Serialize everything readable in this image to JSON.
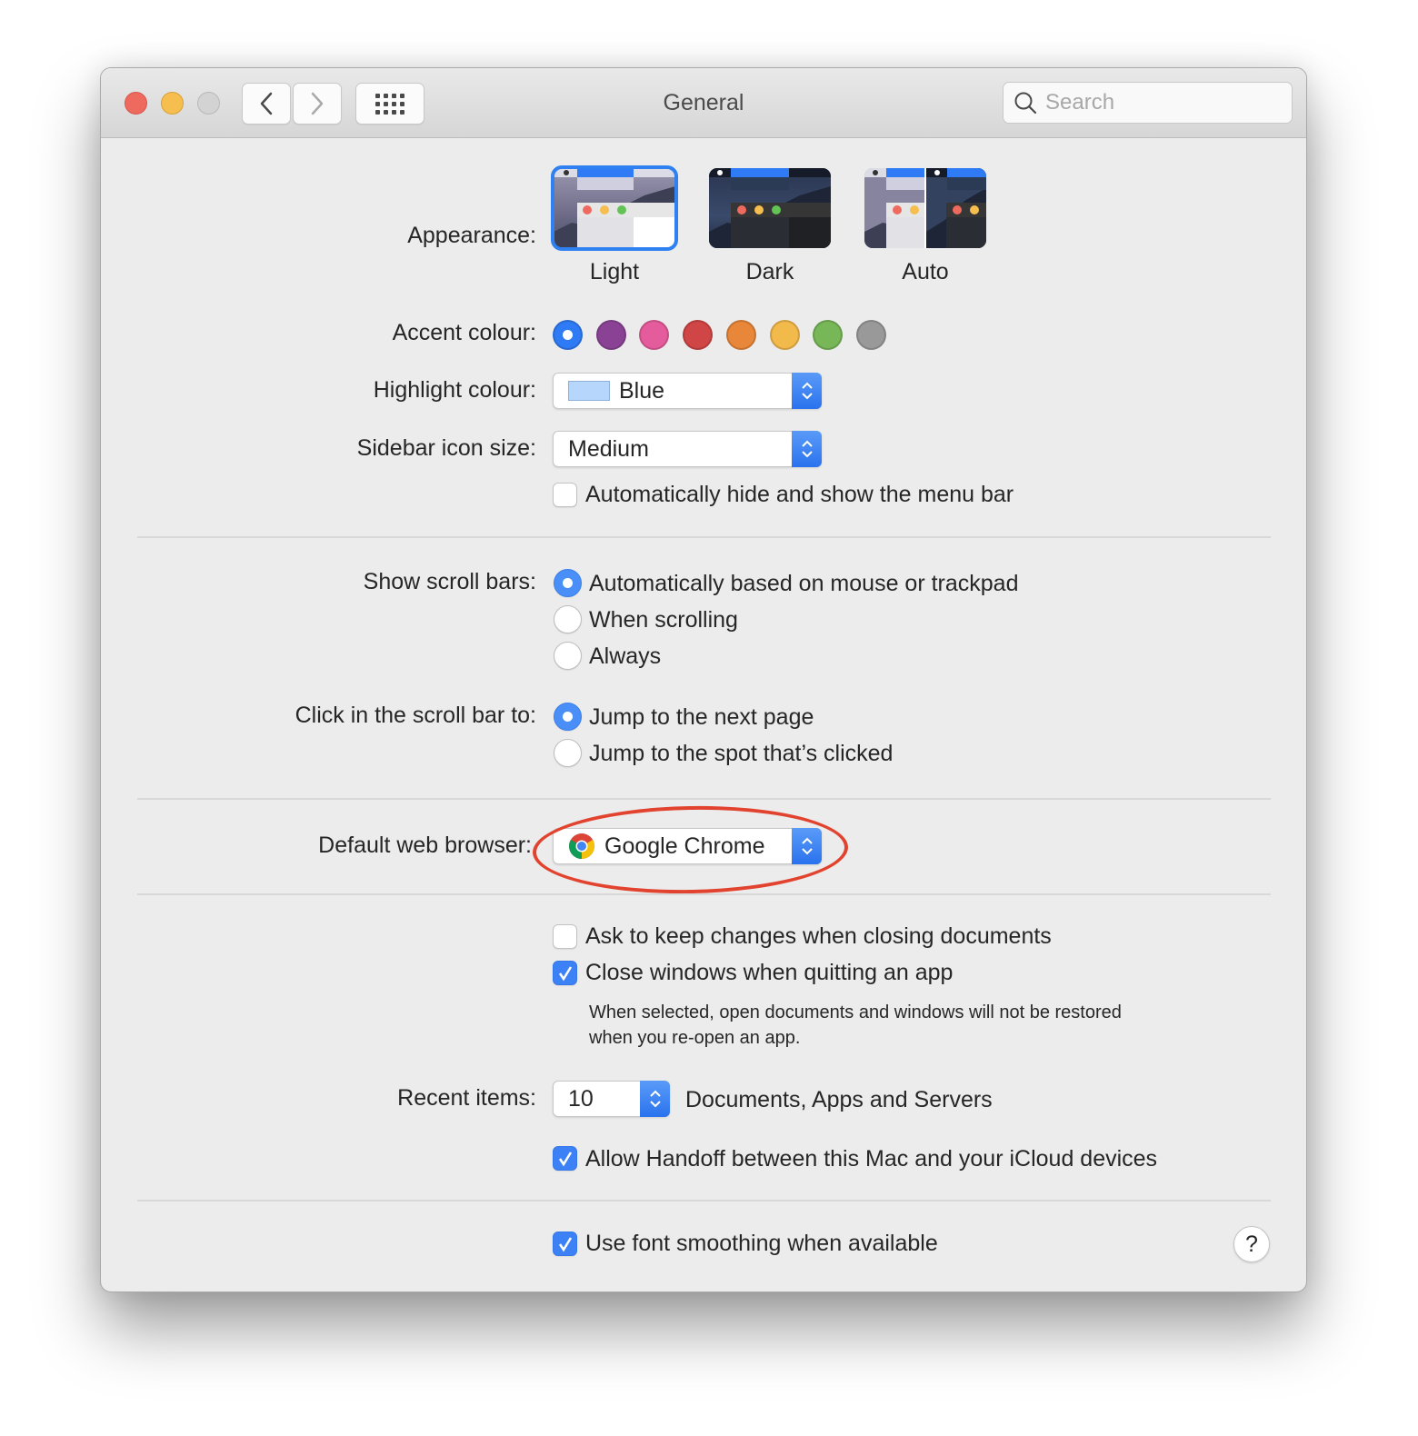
{
  "window": {
    "title": "General",
    "search_placeholder": "Search"
  },
  "toolbar": {
    "back_icon": "chevron-left-icon",
    "forward_icon": "chevron-right-icon",
    "show_all_icon": "grid-icon"
  },
  "appearance": {
    "label": "Appearance:",
    "options": [
      {
        "name": "Light",
        "selected": true
      },
      {
        "name": "Dark",
        "selected": false
      },
      {
        "name": "Auto",
        "selected": false
      }
    ]
  },
  "accent": {
    "label": "Accent colour:",
    "colors": [
      {
        "name": "blue",
        "hex": "#2f7bf5",
        "selected": true
      },
      {
        "name": "purple",
        "hex": "#8a4394"
      },
      {
        "name": "pink",
        "hex": "#e45c9c"
      },
      {
        "name": "red",
        "hex": "#d04545"
      },
      {
        "name": "orange",
        "hex": "#e8863a"
      },
      {
        "name": "yellow",
        "hex": "#f2b94b"
      },
      {
        "name": "green",
        "hex": "#77b757"
      },
      {
        "name": "graphite",
        "hex": "#999999"
      }
    ]
  },
  "highlight": {
    "label": "Highlight colour:",
    "value": "Blue",
    "chip_color": "#b7d6fb"
  },
  "sidebar_icon_size": {
    "label": "Sidebar icon size:",
    "value": "Medium"
  },
  "menu_bar": {
    "label": "Automatically hide and show the menu bar",
    "checked": false
  },
  "scroll_bars": {
    "label": "Show scroll bars:",
    "options": [
      {
        "label": "Automatically based on mouse or trackpad",
        "selected": true
      },
      {
        "label": "When scrolling",
        "selected": false
      },
      {
        "label": "Always",
        "selected": false
      }
    ]
  },
  "click_scroll": {
    "label": "Click in the scroll bar to:",
    "options": [
      {
        "label": "Jump to the next page",
        "selected": true
      },
      {
        "label": "Jump to the spot that’s clicked",
        "selected": false
      }
    ]
  },
  "browser": {
    "label": "Default web browser:",
    "value": "Google Chrome",
    "icon": "chrome-icon",
    "annotation_color": "#e2432e"
  },
  "documents": {
    "ask_keep": {
      "label": "Ask to keep changes when closing documents",
      "checked": false
    },
    "close_windows": {
      "label": "Close windows when quitting an app",
      "checked": true
    },
    "note_line1": "When selected, open documents and windows will not be restored",
    "note_line2": "when you re-open an app."
  },
  "recent_items": {
    "label": "Recent items:",
    "value": "10",
    "suffix": "Documents, Apps and Servers"
  },
  "handoff": {
    "label": "Allow Handoff between this Mac and your iCloud devices",
    "checked": true
  },
  "font_smoothing": {
    "label": "Use font smoothing when available",
    "checked": true
  },
  "help": {
    "label": "?"
  }
}
